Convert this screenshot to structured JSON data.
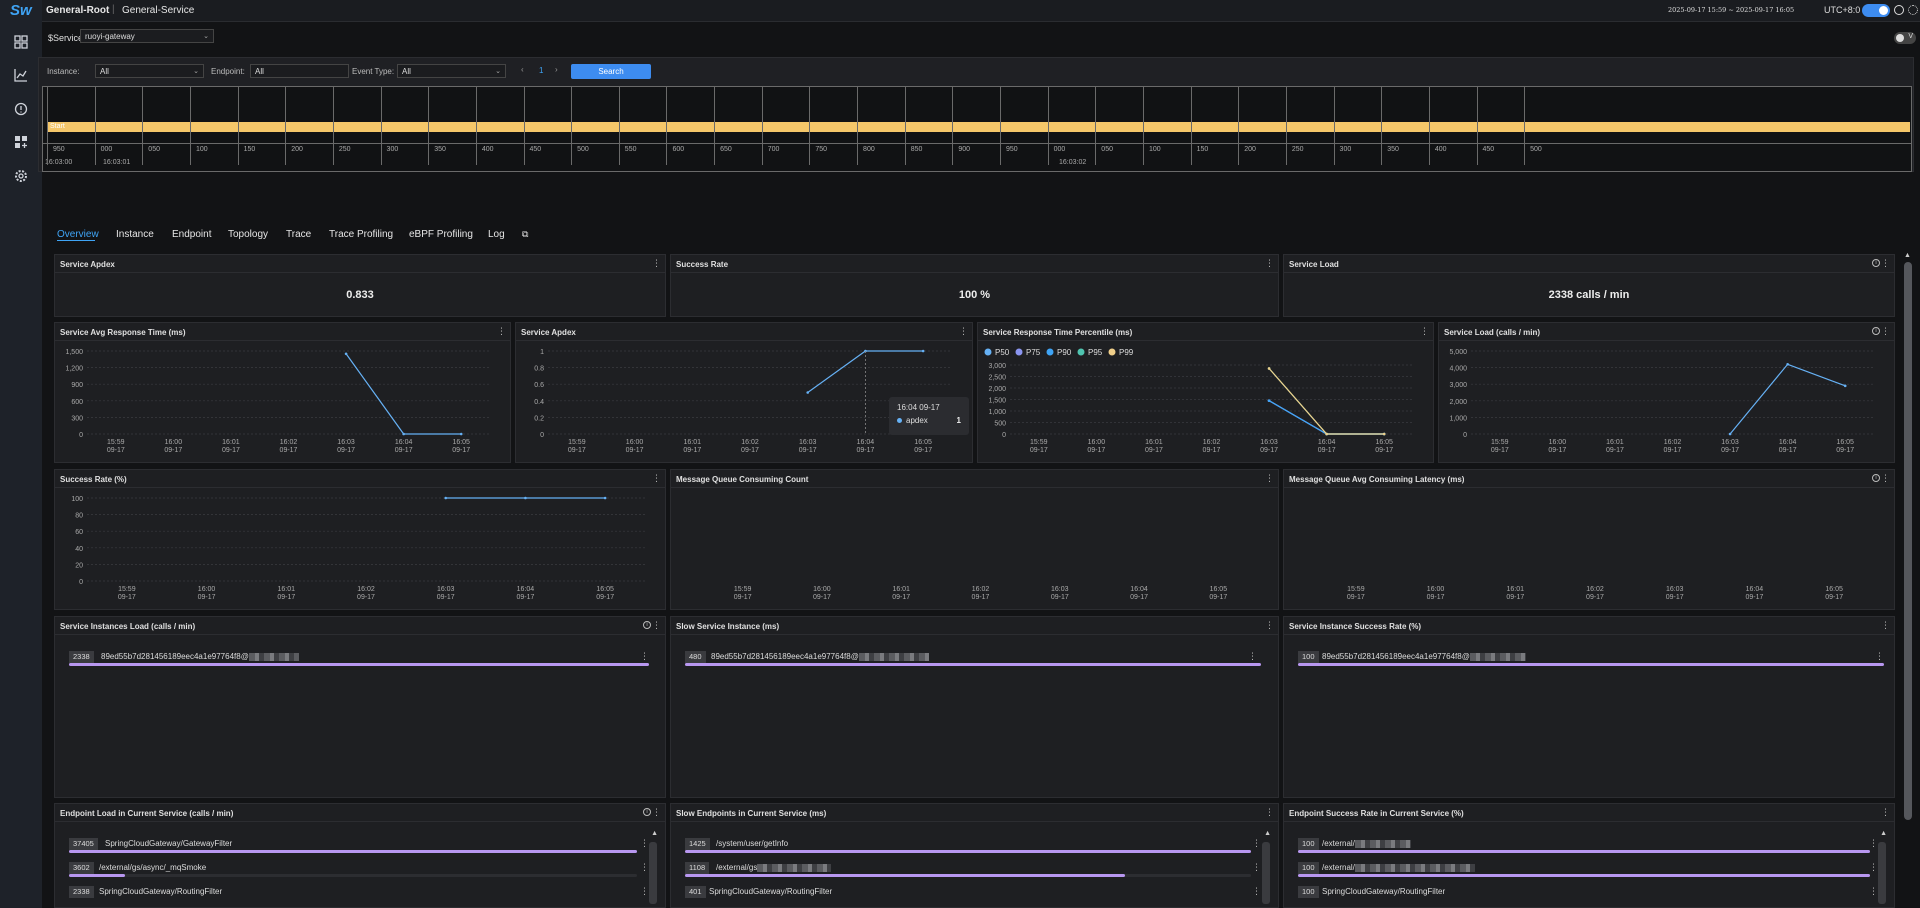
{
  "app": {
    "logo": "Sw",
    "breadcrumb_root": "General-Root",
    "breadcrumb_current": "General-Service",
    "date_range": "2025-09-17 15:59 ~ 2025-09-17 16:05",
    "timezone": "UTC+8:0"
  },
  "service": {
    "label": "$Service",
    "value": "ruoyi-gateway"
  },
  "events": {
    "instance_label": "Instance:",
    "instance_value": "All",
    "endpoint_label": "Endpoint:",
    "endpoint_value": "All",
    "event_type_label": "Event Type:",
    "event_type_value": "All",
    "page": "1",
    "search_label": "Search",
    "bar_label": "Start",
    "tick_labels": [
      "950",
      "000",
      "050",
      "100",
      "150",
      "200",
      "250",
      "300",
      "350",
      "400",
      "450",
      "500",
      "550",
      "600",
      "650",
      "700",
      "750",
      "800",
      "850",
      "900",
      "950",
      "000",
      "050",
      "100",
      "150",
      "200",
      "250",
      "300",
      "350",
      "400",
      "450",
      "500"
    ],
    "time_labels": [
      "16:03:00",
      "16:03:01",
      "16:03:02"
    ]
  },
  "tabs": [
    "Overview",
    "Instance",
    "Endpoint",
    "Topology",
    "Trace",
    "Trace Profiling",
    "eBPF Profiling",
    "Log"
  ],
  "widgets": {
    "apdex_card": {
      "title": "Service Apdex",
      "value": "0.833"
    },
    "success_card": {
      "title": "Success Rate",
      "value": "100 %"
    },
    "load_card": {
      "title": "Service Load",
      "value": "2338 calls / min"
    },
    "avg_resp": {
      "title": "Service Avg Response Time (ms)"
    },
    "apdex_chart": {
      "title": "Service Apdex",
      "tooltip_time": "16:04 09-17",
      "tooltip_series": "apdex",
      "tooltip_value": "1"
    },
    "percentile": {
      "title": "Service Response Time Percentile (ms)"
    },
    "load_chart": {
      "title": "Service Load (calls / min)"
    },
    "success_chart": {
      "title": "Success Rate (%)"
    },
    "mq_count": {
      "title": "Message Queue Consuming Count"
    },
    "mq_latency": {
      "title": "Message Queue Avg Consuming Latency (ms)"
    },
    "inst_load": {
      "title": "Service Instances Load (calls / min)",
      "value": "2338",
      "name": "89ed55b7d281456189eec4a1e97764f8@"
    },
    "slow_inst": {
      "title": "Slow Service Instance (ms)",
      "value": "480",
      "name": "89ed55b7d281456189eec4a1e97764f8@"
    },
    "inst_success": {
      "title": "Service Instance Success Rate (%)",
      "value": "100",
      "name": "89ed55b7d281456189eec4a1e97764f8@"
    },
    "ep_load": {
      "title": "Endpoint Load in Current Service (calls / min)",
      "rows": [
        {
          "value": "37405",
          "name": "SpringCloudGateway/GatewayFilter"
        },
        {
          "value": "3602",
          "name": "/external/gs/async/_mqSmoke"
        },
        {
          "value": "2338",
          "name": "SpringCloudGateway/RoutingFilter"
        }
      ]
    },
    "ep_slow": {
      "title": "Slow Endpoints in Current Service (ms)",
      "rows": [
        {
          "value": "1425",
          "name": "/system/user/getInfo"
        },
        {
          "value": "1108",
          "name": "/external/gs"
        },
        {
          "value": "401",
          "name": "SpringCloudGateway/RoutingFilter"
        }
      ]
    },
    "ep_success": {
      "title": "Endpoint Success Rate in Current Service (%)",
      "rows": [
        {
          "value": "100",
          "name": "/external/"
        },
        {
          "value": "100",
          "name": "/external/"
        },
        {
          "value": "100",
          "name": "SpringCloudGateway/RoutingFilter"
        }
      ]
    }
  },
  "chart_data": [
    {
      "type": "line",
      "title": "Service Avg Response Time (ms)",
      "x": [
        "15:59 09-17",
        "16:00 09-17",
        "16:01 09-17",
        "16:02 09-17",
        "16:03 09-17",
        "16:04 09-17",
        "16:05 09-17"
      ],
      "series": [
        {
          "values": [
            null,
            null,
            null,
            null,
            1450,
            0,
            0
          ],
          "color": "#66b1f5"
        }
      ],
      "ylim": [
        0,
        1500
      ],
      "yticks": [
        0,
        300,
        600,
        900,
        1200,
        1500
      ]
    },
    {
      "type": "line",
      "title": "Service Apdex",
      "x": [
        "15:59 09-17",
        "16:00 09-17",
        "16:01 09-17",
        "16:02 09-17",
        "16:03 09-17",
        "16:04 09-17",
        "16:05 09-17"
      ],
      "series": [
        {
          "name": "apdex",
          "values": [
            null,
            null,
            null,
            null,
            0.5,
            1,
            1
          ],
          "color": "#66b1f5"
        }
      ],
      "ylim": [
        0,
        1
      ],
      "yticks": [
        0,
        0.2,
        0.4,
        0.6,
        0.8,
        1
      ]
    },
    {
      "type": "line",
      "title": "Service Response Time Percentile (ms)",
      "x": [
        "15:59 09-17",
        "16:00 09-17",
        "16:01 09-17",
        "16:02 09-17",
        "16:03 09-17",
        "16:04 09-17",
        "16:05 09-17"
      ],
      "series": [
        {
          "name": "P50",
          "values": [
            null,
            null,
            null,
            null,
            1450,
            0,
            0
          ],
          "color": "#66b1f5"
        },
        {
          "name": "P75",
          "values": [
            null,
            null,
            null,
            null,
            1450,
            0,
            0
          ],
          "color": "#8b95f0"
        },
        {
          "name": "P90",
          "values": [
            null,
            null,
            null,
            null,
            1450,
            0,
            0
          ],
          "color": "#3fa4f5"
        },
        {
          "name": "P95",
          "values": [
            null,
            null,
            null,
            null,
            2850,
            0,
            0
          ],
          "color": "#4fc4b0"
        },
        {
          "name": "P99",
          "values": [
            null,
            null,
            null,
            null,
            2850,
            0,
            0
          ],
          "color": "#f0cf8a"
        }
      ],
      "ylim": [
        0,
        3000
      ],
      "yticks": [
        0,
        500,
        1000,
        1500,
        2000,
        2500,
        3000
      ]
    },
    {
      "type": "line",
      "title": "Service Load (calls / min)",
      "x": [
        "15:59 09-17",
        "16:00 09-17",
        "16:01 09-17",
        "16:02 09-17",
        "16:03 09-17",
        "16:04 09-17",
        "16:05 09-17"
      ],
      "series": [
        {
          "values": [
            null,
            null,
            null,
            null,
            0,
            4200,
            2900
          ],
          "color": "#66b1f5"
        }
      ],
      "ylim": [
        0,
        5000
      ],
      "yticks": [
        0,
        1000,
        2000,
        3000,
        4000,
        5000
      ]
    },
    {
      "type": "line",
      "title": "Success Rate (%)",
      "x": [
        "15:59 09-17",
        "16:00 09-17",
        "16:01 09-17",
        "16:02 09-17",
        "16:03 09-17",
        "16:04 09-17",
        "16:05 09-17"
      ],
      "series": [
        {
          "values": [
            null,
            null,
            null,
            null,
            100,
            100,
            100
          ],
          "color": "#66b1f5"
        }
      ],
      "ylim": [
        0,
        100
      ],
      "yticks": [
        0,
        20,
        40,
        60,
        80,
        100
      ]
    },
    {
      "type": "line",
      "title": "Message Queue Consuming Count",
      "x": [
        "15:59 09-17",
        "16:00 09-17",
        "16:01 09-17",
        "16:02 09-17",
        "16:03 09-17",
        "16:04 09-17",
        "16:05 09-17"
      ],
      "series": []
    },
    {
      "type": "line",
      "title": "Message Queue Avg Consuming Latency (ms)",
      "x": [
        "15:59 09-17",
        "16:00 09-17",
        "16:01 09-17",
        "16:02 09-17",
        "16:03 09-17",
        "16:04 09-17",
        "16:05 09-17"
      ],
      "series": []
    }
  ],
  "colors": {
    "accent": "#3d8cf0",
    "bar": "#b897f0",
    "timeline": "#f5c76a"
  }
}
